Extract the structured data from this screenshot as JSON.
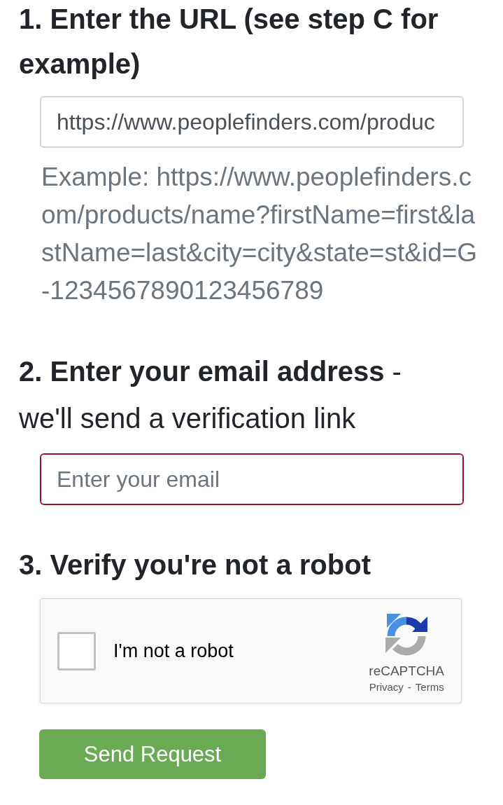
{
  "url_step": {
    "heading": "1. Enter the URL (see step C for example)",
    "url_field": {
      "value": "https://www.peoplefinders.com/produc",
      "invalid": false
    },
    "example": "Example: https://www.peoplefinders.com/products/name?firstName=first&lastName=last&city=city&state=st&id=G-1234567890123456789"
  },
  "email_step": {
    "heading": "**2. Enter your email address** - we'll send a verification link",
    "email_field": {
      "placeholder": "Enter your email",
      "invalid": true
    }
  },
  "robot_step": {
    "heading": "3. Verify you're not a robot",
    "captcha": {
      "checkbox": {
        "label": "I'm not a robot",
        "checked": false
      },
      "brand": "reCAPTCHA",
      "links": [
        "Privacy",
        "Terms"
      ],
      "separator": "-"
    }
  },
  "submit_button": {
    "label": "Send Request"
  }
}
